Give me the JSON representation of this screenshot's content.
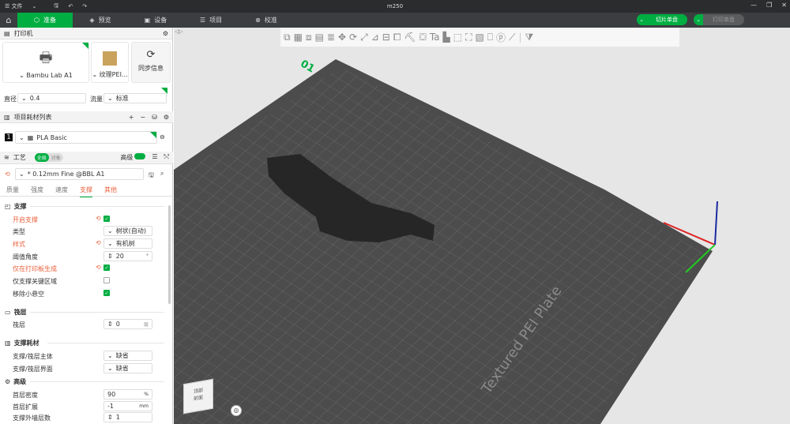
{
  "titlebar": {
    "menu": "文件",
    "title": "m250"
  },
  "tabs": [
    {
      "label": "准备"
    },
    {
      "label": "预览"
    },
    {
      "label": "设备"
    },
    {
      "label": "项目"
    },
    {
      "label": "校准"
    }
  ],
  "actions": {
    "slice": "切片单盘",
    "print": "打印单盘"
  },
  "printer": {
    "header": "打印机",
    "name": "Bambu Lab A1",
    "plate": "纹理PEI...",
    "sync": "同步信息",
    "diameter_label": "直径",
    "diameter": "0.4",
    "flow_label": "流量",
    "flow": "标准"
  },
  "filament": {
    "header": "项目耗材列表",
    "index": "1",
    "name": "PLA Basic"
  },
  "process": {
    "header": "工艺",
    "toggle_global": "全局",
    "toggle_object": "对象",
    "advanced": "高级",
    "preset": "* 0.12mm Fine @BBL A1",
    "tabs": [
      "质量",
      "强度",
      "速度",
      "支撑",
      "其他"
    ]
  },
  "support": {
    "title": "支撑",
    "enable": "开启支撑",
    "type_label": "类型",
    "type": "树状(自动)",
    "style_label": "样式",
    "style": "有机树",
    "angle_label": "阈值角度",
    "angle": "20",
    "angle_unit": "°",
    "buildplate_only": "仅在打印板生成",
    "critical_only": "仅支撑关键区域",
    "remove_small": "移除小悬空"
  },
  "raft": {
    "title": "筏层",
    "layers_label": "筏层",
    "layers": "0",
    "unit": "层"
  },
  "support_filament": {
    "title": "支撑耗材",
    "base_label": "支撑/筏层主体",
    "base": "缺省",
    "interface_label": "支撑/筏层界面",
    "interface": "缺省"
  },
  "advanced": {
    "title": "高级",
    "density_label": "首层密度",
    "density": "90",
    "density_unit": "%",
    "expansion_label": "首层扩展",
    "expansion": "-1",
    "expansion_unit": "mm",
    "interface_label": "支撑外墙层数",
    "interface": "1"
  },
  "plate": {
    "number": "01",
    "label": "Textured PEI Plate",
    "cube_top": "顶部",
    "cube_front": "前面"
  }
}
